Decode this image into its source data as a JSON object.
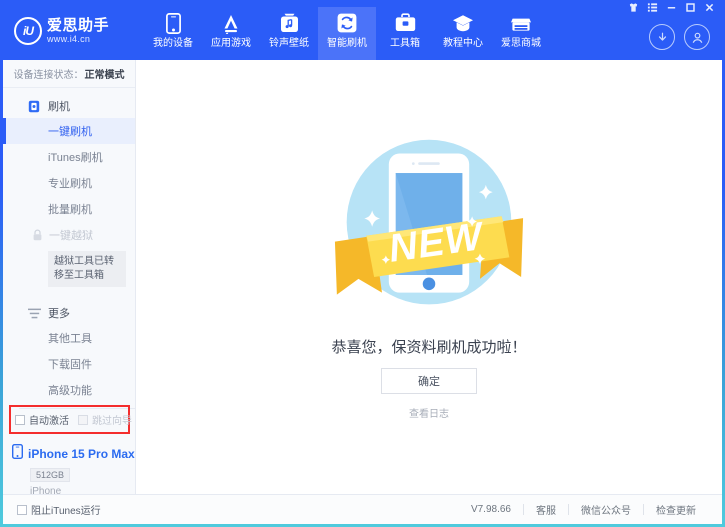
{
  "window": {
    "controls": [
      {
        "name": "skin-icon",
        "label": "皮肤"
      },
      {
        "name": "menu-icon",
        "label": "菜单"
      },
      {
        "name": "minimize-icon",
        "label": "─"
      },
      {
        "name": "maximize-icon",
        "label": "□"
      },
      {
        "name": "close-icon",
        "label": "✕"
      }
    ]
  },
  "header": {
    "logo": {
      "mark": "iU",
      "brand": "爱思助手",
      "url": "www.i4.cn"
    },
    "nav": [
      {
        "label": "我的设备",
        "icon": "phone-icon",
        "active": false
      },
      {
        "label": "应用游戏",
        "icon": "appstore-icon",
        "active": false
      },
      {
        "label": "铃声壁纸",
        "icon": "music-icon",
        "active": false
      },
      {
        "label": "智能刷机",
        "icon": "refresh-icon",
        "active": true
      },
      {
        "label": "工具箱",
        "icon": "toolbox-icon",
        "active": false
      },
      {
        "label": "教程中心",
        "icon": "graduation-cap-icon",
        "active": false
      },
      {
        "label": "爱思商城",
        "icon": "shop-icon",
        "active": false
      }
    ],
    "actions": [
      {
        "name": "download-icon"
      },
      {
        "name": "user-account-icon"
      }
    ]
  },
  "sidebar": {
    "status_label": "设备连接状态：",
    "status_value": "正常模式",
    "groups": [
      {
        "title": "刷机",
        "icon": "flash-device-icon",
        "items": [
          {
            "label": "一键刷机",
            "selected": true,
            "disabled": false
          },
          {
            "label": "iTunes刷机",
            "selected": false,
            "disabled": false
          },
          {
            "label": "专业刷机",
            "selected": false,
            "disabled": false
          },
          {
            "label": "批量刷机",
            "selected": false,
            "disabled": false
          },
          {
            "label": "一键越狱",
            "selected": false,
            "disabled": true
          }
        ]
      },
      {
        "title": "更多",
        "icon": "more-list-icon",
        "items": [
          {
            "label": "其他工具",
            "selected": false,
            "disabled": false
          },
          {
            "label": "下载固件",
            "selected": false,
            "disabled": false
          },
          {
            "label": "高级功能",
            "selected": false,
            "disabled": false
          }
        ]
      }
    ],
    "tooltip": "越狱工具已转移至工具箱",
    "checkboxes": [
      {
        "label": "自动激活",
        "checked": false,
        "disabled": false
      },
      {
        "label": "跳过向导",
        "checked": false,
        "disabled": true
      }
    ],
    "highlight_color": "#f42d2d",
    "device": {
      "name": "iPhone 15 Pro Max",
      "capacity": "512GB",
      "type": "iPhone"
    }
  },
  "main": {
    "illustration": {
      "name": "new-phone-ribbon-illustration",
      "badge_text": "NEW"
    },
    "message": "恭喜您，保资料刷机成功啦！",
    "primary_button": "确定",
    "log_link": "查看日志"
  },
  "statusbar": {
    "block_itunes": {
      "label": "阻止iTunes运行",
      "checked": false
    },
    "version": "V7.98.66",
    "links": [
      {
        "label": "客服"
      },
      {
        "label": "微信公众号"
      },
      {
        "label": "检查更新"
      }
    ]
  },
  "colors": {
    "brand_blue": "#2b5cf7",
    "nav_active": "#4b73f9",
    "sidebar_bg": "#f7f9fc",
    "select_bg": "#e9effd",
    "highlight_red": "#f42d2d",
    "illustration_circle": "#b7e3f6",
    "ribbon_yellow": "#fddc4f"
  }
}
